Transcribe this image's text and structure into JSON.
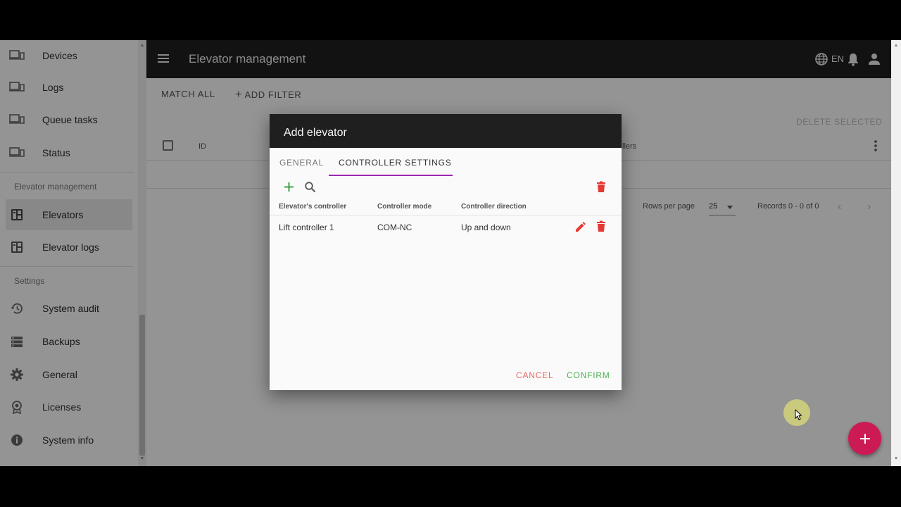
{
  "sidebar": {
    "items_top": [
      {
        "label": "Devices",
        "icon": "devices-icon"
      },
      {
        "label": "Logs",
        "icon": "devices-icon"
      },
      {
        "label": "Queue tasks",
        "icon": "devices-icon"
      },
      {
        "label": "Status",
        "icon": "devices-icon"
      }
    ],
    "section_elevator": "Elevator management",
    "items_elevator": [
      {
        "label": "Elevators",
        "icon": "dashboard-icon",
        "active": true
      },
      {
        "label": "Elevator logs",
        "icon": "dashboard-icon"
      }
    ],
    "section_settings": "Settings",
    "items_settings": [
      {
        "label": "System audit",
        "icon": "history-icon"
      },
      {
        "label": "Backups",
        "icon": "storage-icon"
      },
      {
        "label": "General",
        "icon": "gear-icon"
      },
      {
        "label": "Licenses",
        "icon": "badge-icon"
      },
      {
        "label": "System info",
        "icon": "info-icon"
      }
    ]
  },
  "topbar": {
    "title": "Elevator management",
    "language": "EN"
  },
  "filters": {
    "match_all": "MATCH ALL",
    "add_filter": "ADD FILTER"
  },
  "table": {
    "delete_selected": "DELETE SELECTED",
    "col_id": "ID",
    "col_controllers_partial": "llers",
    "rows_per_page_label": "Rows per page",
    "rows_per_page_value": "25",
    "records": "Records 0 - 0 of 0"
  },
  "dialog": {
    "title": "Add elevator",
    "tabs": [
      {
        "label": "GENERAL",
        "active": false
      },
      {
        "label": "CONTROLLER SETTINGS",
        "active": true
      }
    ],
    "columns": [
      "Elevator's controller",
      "Controller mode",
      "Controller direction"
    ],
    "rows": [
      {
        "controller": "Lift controller 1",
        "mode": "COM-NC",
        "direction": "Up and down"
      }
    ],
    "cancel": "CANCEL",
    "confirm": "CONFIRM"
  },
  "colors": {
    "topbar": "#1f1f1f",
    "accent_tab": "#9c27b0",
    "fab": "#cc1a55",
    "delete": "#e53935",
    "add": "#43a047",
    "confirm": "#4caf50",
    "cancel": "#e5675f"
  }
}
